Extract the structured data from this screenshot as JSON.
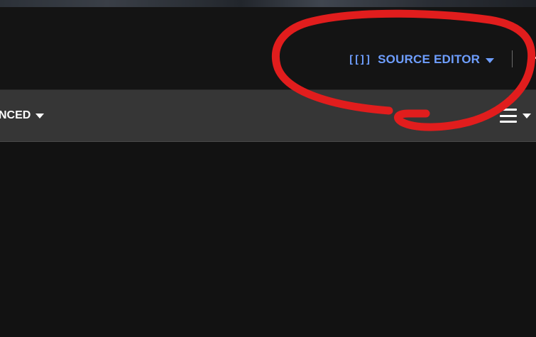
{
  "header": {
    "editor_switcher": {
      "icon": "source-brackets-icon",
      "icon_glyph": "[[]]",
      "label": "SOURCE EDITOR",
      "accent_color": "#6e9eff"
    }
  },
  "toolbar": {
    "advanced_label": "NCED",
    "toc_icon": "hamburger-icon"
  },
  "annotation": {
    "shape": "freehand-circle",
    "color": "#e11d1d",
    "target": "editor_switcher"
  }
}
